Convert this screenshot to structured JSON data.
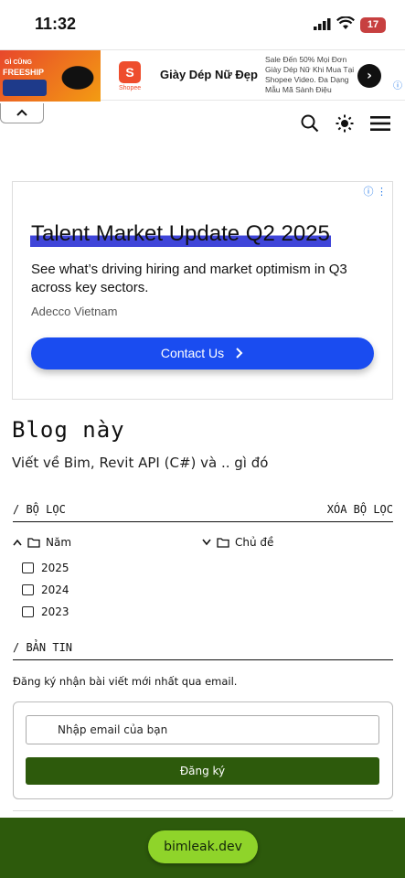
{
  "status_bar": {
    "time": "11:32",
    "battery": "17"
  },
  "top_ad": {
    "banner_line1": "GÌ CŨNG",
    "banner_line2": "FREESHIP",
    "brand": "Shopee",
    "title": "Giày Dép Nữ Đẹp",
    "description": "Sale Đến 50% Mọi Đơn Giày Dép Nữ Khi Mua Tại Shopee Video. Đa Dạng Mẫu Mã Sành Điệu"
  },
  "content_ad": {
    "headline": "Talent Market Update Q2 2025",
    "body": "See what’s driving hiring and market optimism in Q3 across key sectors.",
    "advertiser": "Adecco Vietnam",
    "cta": "Contact Us"
  },
  "blog": {
    "title": "Blog này",
    "subtitle": "Viết về Bim, Revit API (C#) và .. gì đó"
  },
  "filter": {
    "heading": "/ BỘ LỌC",
    "clear": "XÓA BỘ LỌC",
    "year_label": "Năm",
    "topic_label": "Chủ đề",
    "years": [
      "2025",
      "2024",
      "2023"
    ]
  },
  "newsletter": {
    "heading": "/ BẢN TIN",
    "description": "Đăng ký nhận bài viết mới nhất qua email.",
    "email_placeholder": "Nhập email của bạn",
    "subscribe_label": "Đăng ký"
  },
  "footer": {
    "domain": "bimleak.dev"
  },
  "colors": {
    "primary_green": "#2d5a0c",
    "pill_green": "#8fd42a",
    "cta_blue": "#1a4cf0"
  }
}
